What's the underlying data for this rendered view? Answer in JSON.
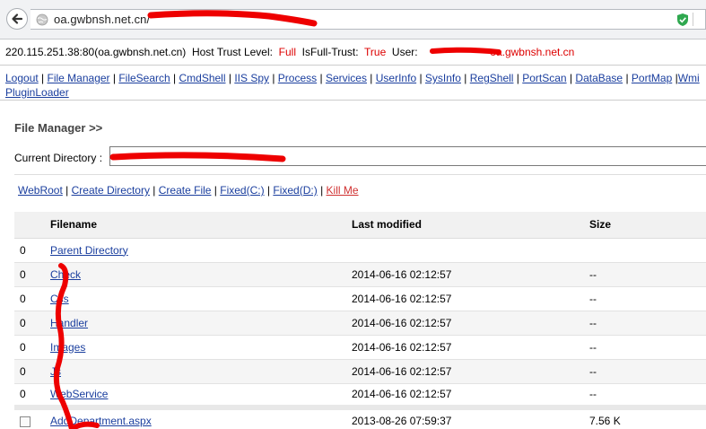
{
  "browser": {
    "url": "oa.gwbnsh.net.cn/",
    "back_icon": "arrow-left-icon",
    "site_icon": "globe-icon",
    "shield_icon": "shield-check-icon"
  },
  "info": {
    "host_port": "220.115.251.38:80(oa.gwbnsh.net.cn)",
    "trust_label": "Host Trust Level:",
    "trust_value": "Full",
    "isfull_label": "IsFull-Trust:",
    "isfull_value": "True",
    "user_label": "User:",
    "user_value": "oa.gwbnsh.net.cn"
  },
  "nav": {
    "items": [
      "Logout",
      "File Manager",
      "FileSearch",
      "CmdShell",
      "IIS Spy",
      "Process",
      "Services",
      "UserInfo",
      "SysInfo",
      "RegShell",
      "PortScan",
      "DataBase",
      "PortMap",
      "Wmi",
      "PluginLoader"
    ]
  },
  "file_manager": {
    "title": "File Manager >>",
    "current_dir_label": "Current Directory :",
    "toolbar": [
      "WebRoot",
      "Create Directory",
      "Create File",
      "Fixed(C:)",
      "Fixed(D:)",
      "Kill Me"
    ],
    "columns": [
      "",
      "Filename",
      "Last modified",
      "Size"
    ],
    "rows": [
      {
        "id": "0",
        "name": "Parent Directory",
        "modified": "",
        "size": ""
      },
      {
        "id": "0",
        "name": "Check",
        "modified": "2014-06-16 02:12:57",
        "size": "--"
      },
      {
        "id": "0",
        "name": "Css",
        "modified": "2014-06-16 02:12:57",
        "size": "--"
      },
      {
        "id": "0",
        "name": "Handler",
        "modified": "2014-06-16 02:12:57",
        "size": "--"
      },
      {
        "id": "0",
        "name": "Images",
        "modified": "2014-06-16 02:12:57",
        "size": "--"
      },
      {
        "id": "0",
        "name": "Js",
        "modified": "2014-06-16 02:12:57",
        "size": "--"
      },
      {
        "id": "0",
        "name": "WebService",
        "modified": "2014-06-16 02:12:57",
        "size": "--"
      }
    ],
    "last_row": {
      "name": "AddDepartment.aspx",
      "modified": "2013-08-26 07:59:37",
      "size": "7.56 K"
    }
  },
  "colors": {
    "link": "#1a3e9e",
    "red": "#dd0000",
    "scribble": "#ee0000"
  }
}
